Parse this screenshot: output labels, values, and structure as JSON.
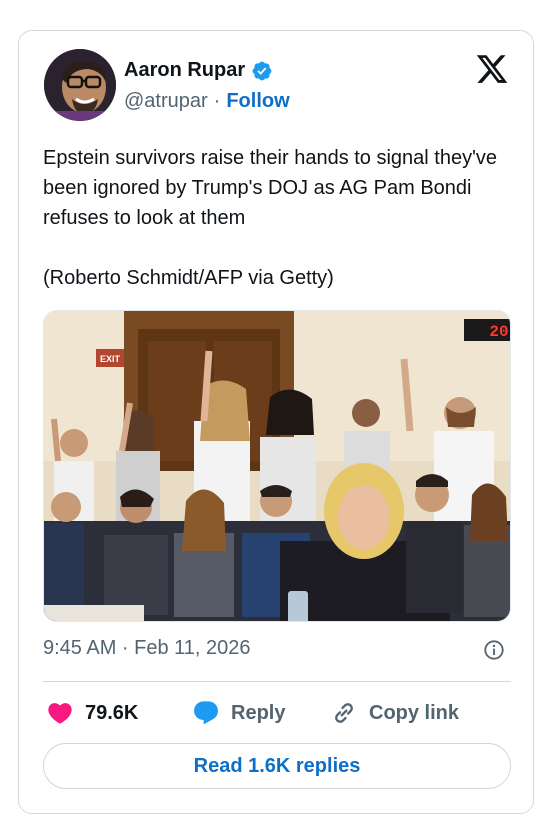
{
  "author": {
    "name": "Aaron Rupar",
    "handle": "@atrupar",
    "separator": "·",
    "follow_label": "Follow",
    "verified": true
  },
  "tweet": {
    "text": "Epstein survivors raise their hands to signal they've been ignored by Trump's DOJ as AG Pam Bondi refuses to look at them\n\n(Roberto Schmidt/AFP via Getty)",
    "timestamp": "9:45 AM · Feb 11, 2026"
  },
  "photo": {
    "exit_sign": "EXIT",
    "timer": "20"
  },
  "actions": {
    "likes": "79.6K",
    "reply_label": "Reply",
    "copy_link_label": "Copy link"
  },
  "read_replies_label": "Read 1.6K replies",
  "colors": {
    "accent": "#0f6fc6",
    "like": "#f91880",
    "reply": "#1d9bf0",
    "secondary_text": "#536471",
    "border": "#cfd9de"
  }
}
